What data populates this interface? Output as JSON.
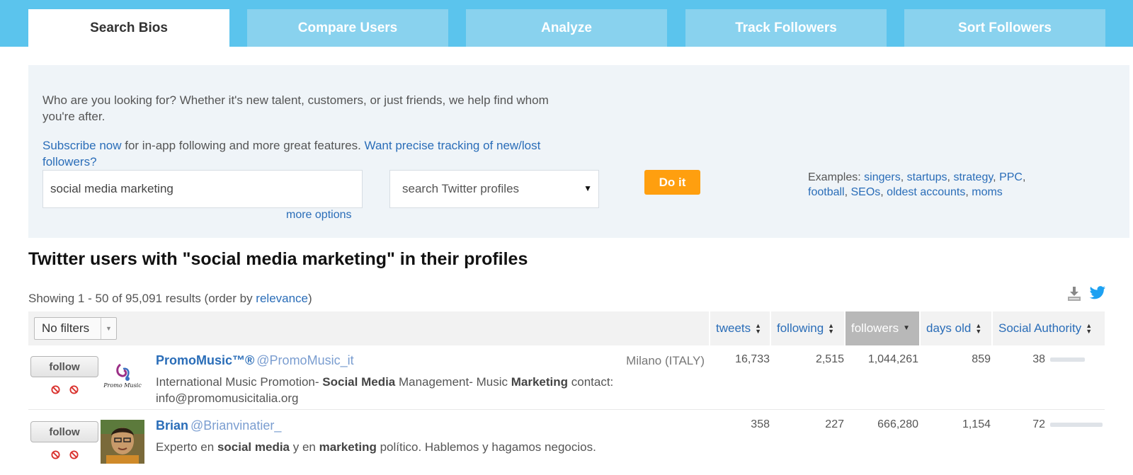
{
  "tabs": [
    {
      "label": "Search Bios",
      "active": true
    },
    {
      "label": "Compare Users",
      "active": false
    },
    {
      "label": "Analyze",
      "active": false
    },
    {
      "label": "Track Followers",
      "active": false
    },
    {
      "label": "Sort Followers",
      "active": false
    }
  ],
  "search_panel": {
    "intro": "Who are you looking for? Whether it's new talent, customers, or just friends, we help find whom you're after.",
    "subscribe_link": "Subscribe now",
    "subscribe_text": " for in-app following and more great features. ",
    "tracking_link": "Want precise tracking of new/lost followers?",
    "query_value": "social media marketing",
    "more_options": "more options",
    "search_type": "search Twitter profiles",
    "submit_label": "Do it",
    "examples_label": "Examples:",
    "examples": [
      "singers",
      "startups",
      "strategy",
      "PPC",
      "football",
      "SEOs",
      "oldest accounts",
      "moms"
    ]
  },
  "results": {
    "title": "Twitter users with \"social media marketing\" in their profiles",
    "showing_prefix": "Showing 1 - 50 of 95,091 results (order by ",
    "order_link": "relevance",
    "showing_suffix": ")",
    "filter_value": "No filters",
    "columns": [
      "tweets",
      "following",
      "followers",
      "days old",
      "Social Authority"
    ],
    "sorted_column": "followers",
    "follow_label": "follow",
    "rows": [
      {
        "name": "PromoMusic™®",
        "handle": "@PromoMusic_it",
        "location": "Milano (ITALY)",
        "bio_html": "International Music Promotion- <b>Social Media</b> Management- Music <b>Marketing</b> contact: info@promomusicitalia.org",
        "tweets": "16,733",
        "following": "2,515",
        "followers": "1,044,261",
        "days_old": "859",
        "social_authority": "38",
        "avatar": "promomusic-logo"
      },
      {
        "name": "Brian",
        "handle": "@Brianvinatier_",
        "location": "",
        "bio_html": "Experto en <b>social media</b> y en <b>marketing</b> político. Hablemos y hagamos negocios.",
        "tweets": "358",
        "following": "227",
        "followers": "666,280",
        "days_old": "1,154",
        "social_authority": "72",
        "avatar": "profile-photo"
      }
    ]
  },
  "colors": {
    "topbar": "#5bc4ed",
    "tab_inactive": "#89d2ee",
    "link": "#2a6db8",
    "submit": "#ff9f0f",
    "panel": "#eff4f8"
  }
}
